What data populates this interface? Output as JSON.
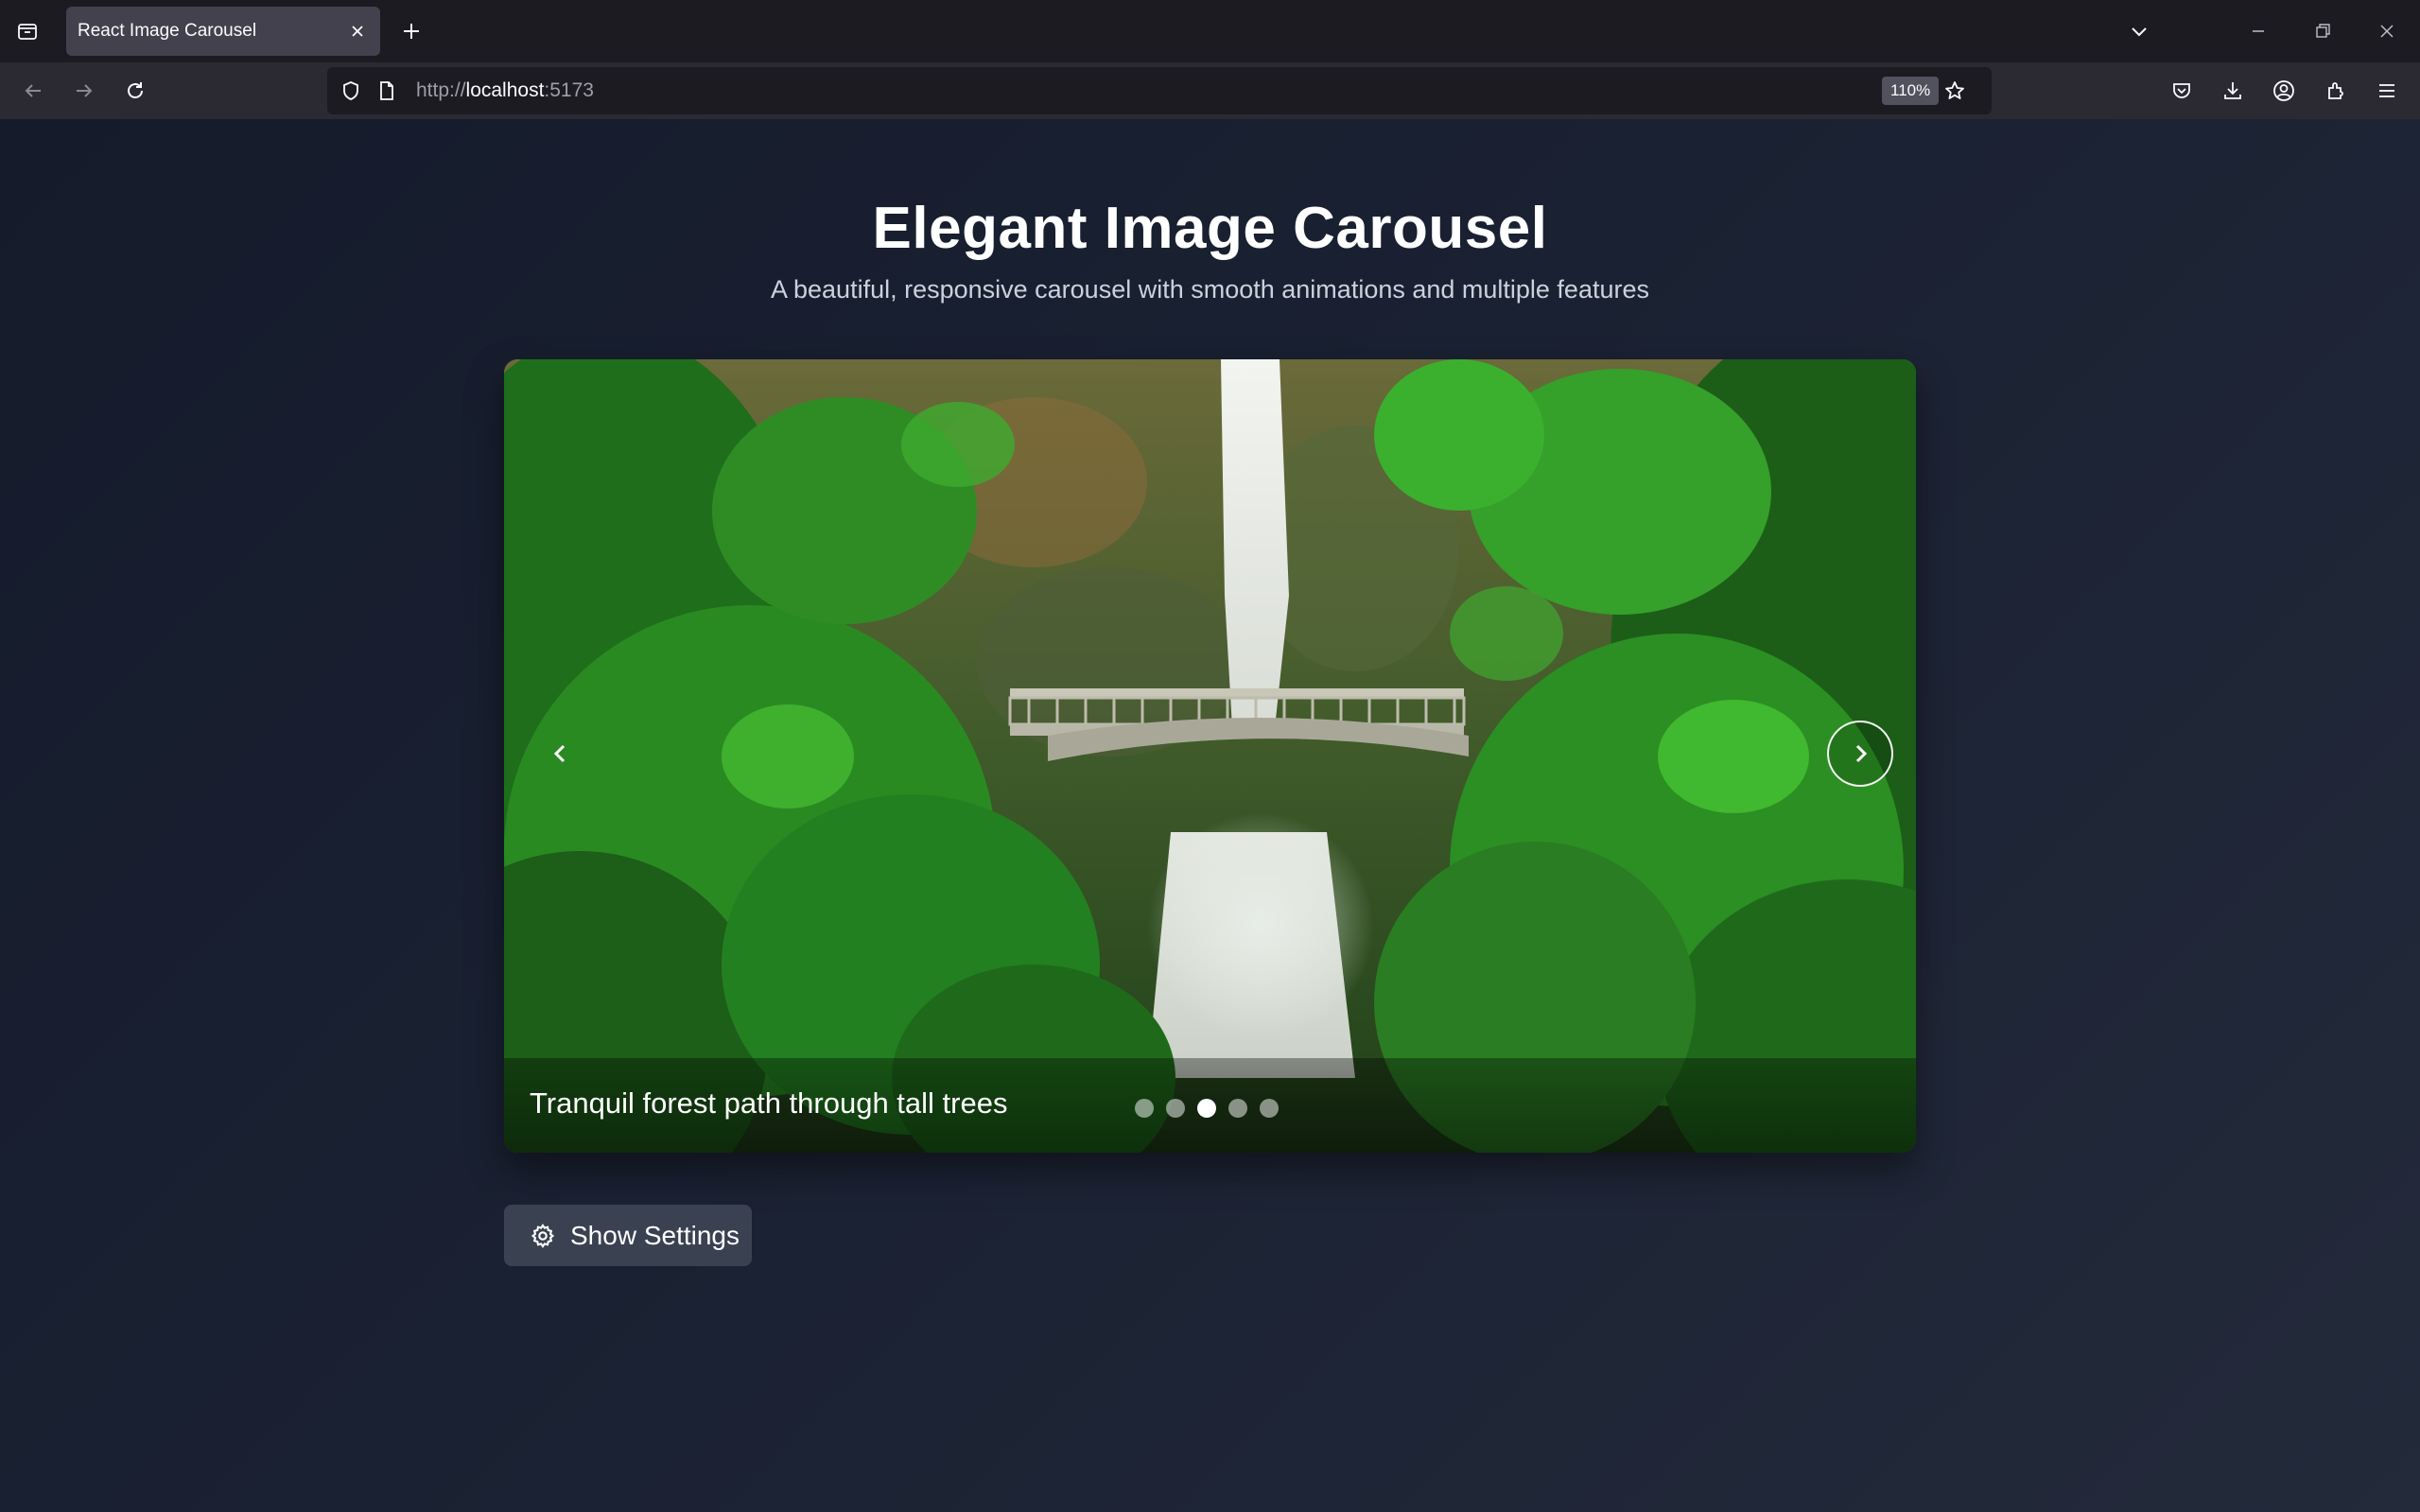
{
  "browser": {
    "tab_title": "React Image Carousel",
    "url_scheme": "http://",
    "url_host": "localhost",
    "url_port": ":5173",
    "zoom": "110%"
  },
  "page": {
    "title": "Elegant Image Carousel",
    "subtitle": "A beautiful, responsive carousel with smooth animations and multiple features"
  },
  "carousel": {
    "caption": "Tranquil forest path through tall trees",
    "slide_count": 5,
    "active_index": 2,
    "slide_image": "waterfall-bridge-forest"
  },
  "settings": {
    "button_label": "Show Settings",
    "icon": "gear-icon"
  },
  "colors": {
    "background": "#1a2132",
    "button_bg": "#3a4252",
    "text": "#ffffff"
  }
}
